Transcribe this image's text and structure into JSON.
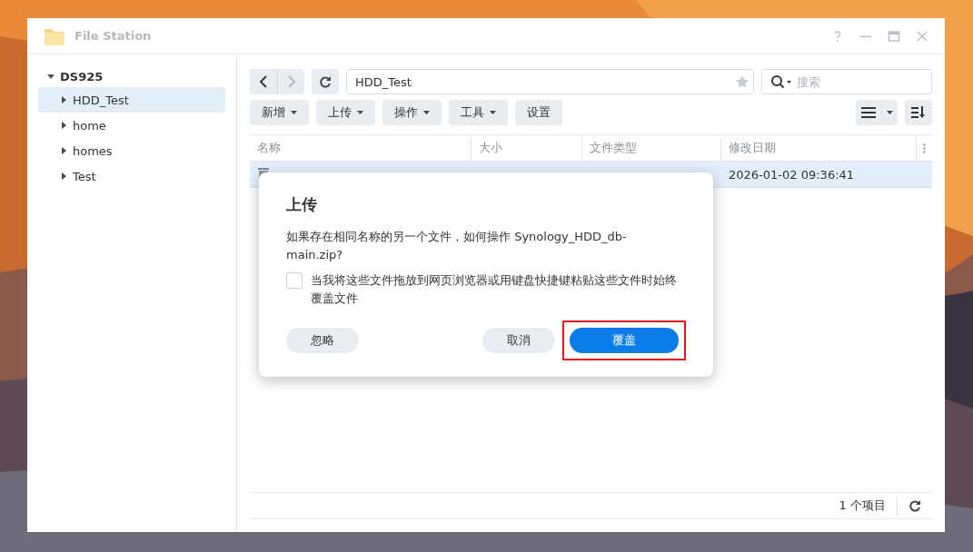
{
  "window": {
    "title": "File Station"
  },
  "sidebar": {
    "root": {
      "label": "DS925",
      "expanded": true,
      "children": [
        {
          "label": "HDD_Test",
          "selected": true
        },
        {
          "label": "home",
          "selected": false
        },
        {
          "label": "homes",
          "selected": false
        },
        {
          "label": "Test",
          "selected": false
        }
      ]
    }
  },
  "path_field": {
    "value": "HDD_Test"
  },
  "search": {
    "placeholder": "搜索"
  },
  "toolbar": {
    "buttons": [
      {
        "label": "新增",
        "dropdown": true
      },
      {
        "label": "上传",
        "dropdown": true
      },
      {
        "label": "操作",
        "dropdown": true
      },
      {
        "label": "工具",
        "dropdown": true
      },
      {
        "label": "设置",
        "dropdown": false
      }
    ]
  },
  "table": {
    "columns": [
      "名称",
      "大小",
      "文件类型",
      "修改日期"
    ],
    "rows": [
      {
        "modified": "2026-01-02 09:36:41",
        "selected": true
      }
    ]
  },
  "status_bar": {
    "count": "1 个项目"
  },
  "dialog": {
    "title": "上传",
    "message": "如果存在相同名称的另一个文件，如何操作 Synology_HDD_db-main.zip?",
    "checkbox": {
      "label": "当我将这些文件拖放到网页浏览器或用键盘快捷键粘贴这些文件时始终覆盖文件",
      "checked": false
    },
    "buttons": [
      {
        "label": "忽略",
        "kind": "secondary",
        "highlighted": false
      },
      {
        "label": "取消",
        "kind": "secondary",
        "highlighted": false
      },
      {
        "label": "覆盖",
        "kind": "primary",
        "highlighted": true
      }
    ]
  }
}
